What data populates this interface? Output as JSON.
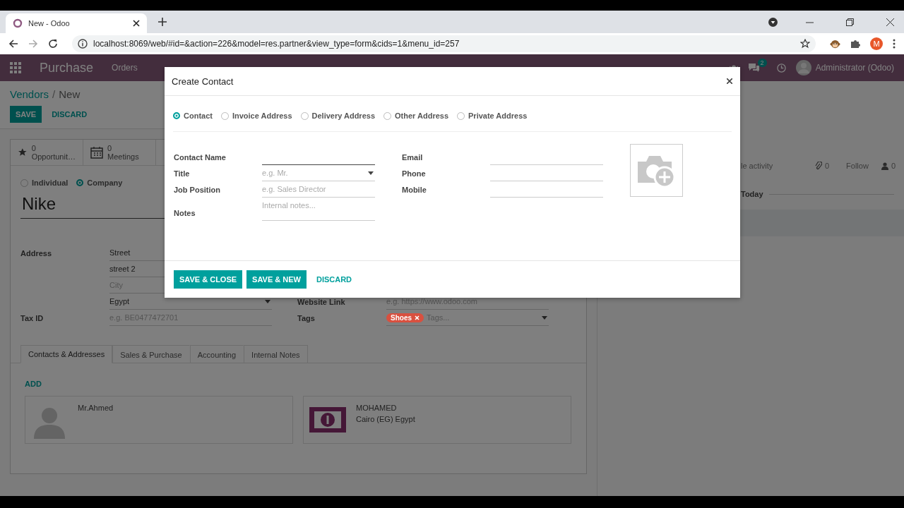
{
  "browser": {
    "tab_title": "New - Odoo",
    "url": "localhost:8069/web/#id=&action=226&model=res.partner&view_type=form&cids=1&menu_id=257",
    "profile_initial": "M"
  },
  "navbar": {
    "app_name": "Purchase",
    "menu": [
      "Orders"
    ],
    "messages_count": "2",
    "user": "Administrator (Odoo)"
  },
  "control_panel": {
    "breadcrumb": [
      "Vendors",
      "New"
    ],
    "separator": "/",
    "save": "SAVE",
    "discard": "DISCARD"
  },
  "smart_buttons": [
    {
      "kind": "star",
      "count": "0",
      "label": "Opportunit…"
    },
    {
      "kind": "calendar",
      "count": "0",
      "label": "Meetings"
    }
  ],
  "company_type": [
    {
      "label": "Individual",
      "selected": false
    },
    {
      "label": "Company",
      "selected": true
    }
  ],
  "name": "Nike",
  "address": {
    "label": "Address",
    "lines": [
      {
        "value": "Street"
      },
      {
        "value": "street 2"
      },
      {
        "placeholder": "City"
      },
      {
        "value": "Egypt",
        "dropdown": true
      }
    ]
  },
  "tax_id": {
    "label": "Tax ID",
    "placeholder": "e.g. BE0477472701"
  },
  "website": {
    "label": "Website Link",
    "placeholder": "e.g. https://www.odoo.com"
  },
  "tags": {
    "label": "Tags",
    "items": [
      {
        "label": "Shoes",
        "color": "#d9503f"
      }
    ],
    "placeholder": "Tags..."
  },
  "notebook_tabs": [
    {
      "label": "Contacts & Addresses",
      "selected": true
    },
    {
      "label": "Sales & Purchase",
      "selected": false
    },
    {
      "label": "Accounting",
      "selected": false
    },
    {
      "label": "Internal Notes",
      "selected": false
    }
  ],
  "add": "ADD",
  "contacts": [
    {
      "kind": "person",
      "name": "Mr.Ahmed"
    },
    {
      "kind": "invoice",
      "name": "MOHAMED",
      "address": "Cairo (EG) Egypt"
    }
  ],
  "chatter": {
    "activity": "le activity",
    "attachments": "0",
    "follow": "Follow",
    "followers": "0",
    "today": "Today"
  },
  "dialog": {
    "title": "Create Contact",
    "types": [
      {
        "label": "Contact",
        "selected": true
      },
      {
        "label": "Invoice Address",
        "selected": false
      },
      {
        "label": "Delivery Address",
        "selected": false
      },
      {
        "label": "Other Address",
        "selected": false
      },
      {
        "label": "Private Address",
        "selected": false
      }
    ],
    "left_fields": [
      {
        "kind": "text",
        "label": "Contact Name",
        "focused": true
      },
      {
        "kind": "select",
        "label": "Title",
        "placeholder": "e.g. Mr."
      },
      {
        "kind": "text",
        "label": "Job Position",
        "placeholder": "e.g. Sales Director"
      },
      {
        "kind": "textarea",
        "label": "Notes",
        "placeholder": "Internal notes..."
      }
    ],
    "right_fields": [
      {
        "kind": "text",
        "label": "Email"
      },
      {
        "kind": "text",
        "label": "Phone"
      },
      {
        "kind": "text",
        "label": "Mobile"
      }
    ],
    "buttons": [
      {
        "kind": "primary",
        "label": "SAVE & CLOSE"
      },
      {
        "kind": "primary",
        "label": "SAVE & NEW"
      },
      {
        "kind": "link",
        "label": "DISCARD"
      }
    ]
  }
}
